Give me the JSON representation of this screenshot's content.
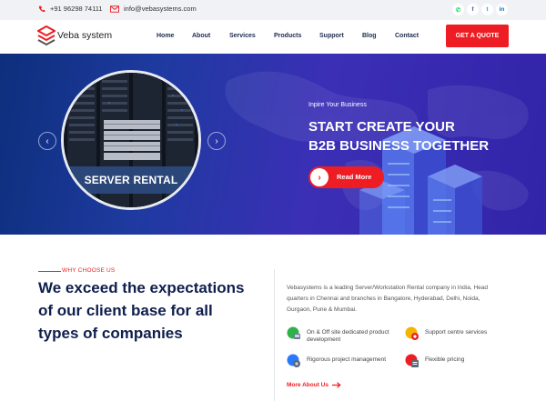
{
  "topbar": {
    "phone": "+91 96298 74111",
    "email": "info@vebasystems.com",
    "phone_icon": "phone-icon",
    "email_icon": "mail-icon",
    "socials": [
      {
        "icon": "whatsapp-icon",
        "glyph": "✆",
        "color": "#25d366"
      },
      {
        "icon": "facebook-icon",
        "glyph": "f",
        "color": "#3b5998"
      },
      {
        "icon": "twitter-icon",
        "glyph": "t",
        "color": "#1da1f2"
      },
      {
        "icon": "linkedin-icon",
        "glyph": "in",
        "color": "#0077b5"
      }
    ]
  },
  "header": {
    "logo_text": "Veba system",
    "nav": [
      "Home",
      "About",
      "Services",
      "Products",
      "Support",
      "Blog",
      "Contact"
    ],
    "cta": "GET A QUOTE"
  },
  "hero": {
    "slide_label": "SERVER RENTAL",
    "subtitle": "Inpire Your Business",
    "title_line1": "START CREATE YOUR",
    "title_line2": "B2B BUSINESS TOGETHER",
    "button": "Read More",
    "prev": "‹",
    "next": "›"
  },
  "why": {
    "tag": "WHY CHOOSE US",
    "heading": "We exceed the expectations of our client base for all types of companies",
    "paragraph": "Vebasystems is a leading Server/Workstation Rental company in India, Head quarters in Chennai and branches in Bangalore, Hyderabad, Delhi, Noida, Gurgaon, Pune & Mumbai.",
    "features": [
      {
        "label": "On & Off site dedicated product development",
        "icon": "development-icon"
      },
      {
        "label": "Support centre services",
        "icon": "support-icon"
      },
      {
        "label": "Rigorous project management",
        "icon": "project-management-icon"
      },
      {
        "label": "Flexible pricing",
        "icon": "pricing-icon"
      }
    ],
    "more": "More About Us"
  },
  "colors": {
    "accent": "#ee1d23",
    "navy": "#0e1f4d",
    "hero_start": "#0d2f7c",
    "hero_end": "#3224a8"
  }
}
